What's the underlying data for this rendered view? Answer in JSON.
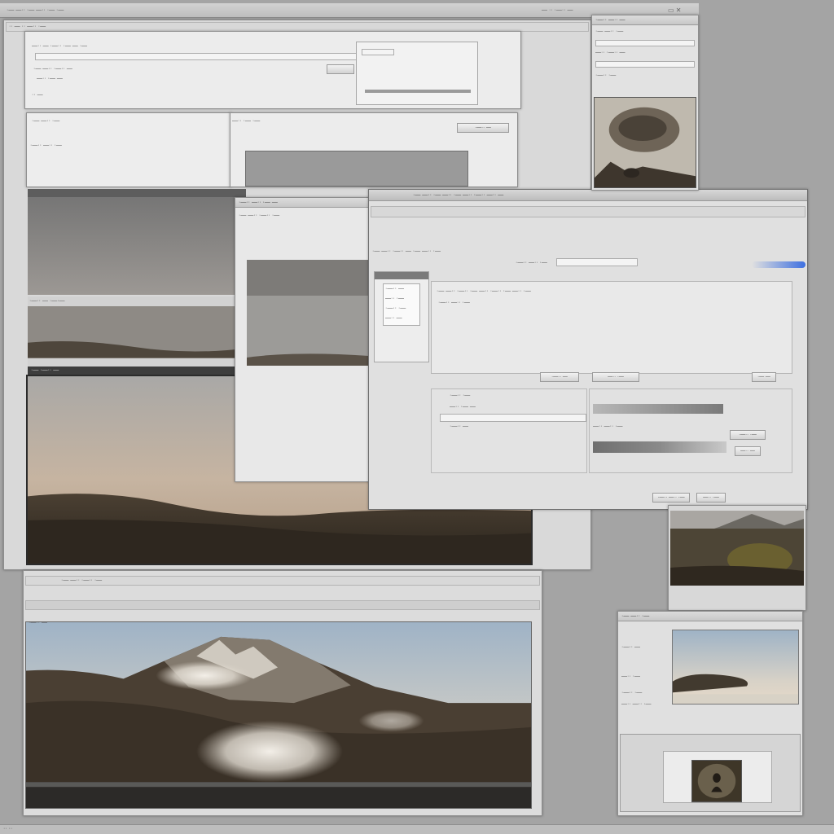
{
  "screen": {
    "title": "Photo editing workspace with overlapping windows",
    "top_status": "— ·· ·—·· —",
    "bottom_status": "·· ··"
  },
  "windows": {
    "main": {
      "title": "·— —·· ·— —·· ·— ·—",
      "toolbar_text": "·· — ·· —·· ·—",
      "row1": "—·· — ·—·· ·— — ·—",
      "row2": "·— —·· ·—·· —",
      "row3": "—·· ·— —",
      "row4": "·· —",
      "panel_left_title": "·— —·· ·—",
      "panel_right_title": "—·· ·— ·—",
      "panel_right_btn": "·—·· —",
      "label_a": "·—·· —·· ·—",
      "strip_label": "·—·· — ·—·—",
      "image_label": "·— ·—·· —"
    },
    "bottom": {
      "toolbar_text": "·— —·· ·—·· ·—",
      "image_label": "·—·· —"
    },
    "dialog": {
      "title": "·— —·· ·— —·· ·— —·· ·—·· —·· —",
      "heading": "·— —·· ·—·· — ·— —·· ·—",
      "search_label": "·—·· —·· ·—",
      "list_items": [
        "·—·· —",
        "—·· ·—",
        "·—·· ·—",
        "—·· —"
      ],
      "path_text": "·— —·· ·—·· ·— —·· ·—·· ·— —·· ·—",
      "option_a": "·—·· —·· ·—",
      "option_b": "—·· ·— —",
      "option_c": "·—·· —",
      "sub_label_1": "·—·· ·—",
      "sub_label_2": "—·· —·· ·—",
      "btn_1": "·—·· —",
      "btn_2": "—·· ·—",
      "btn_3": "·— —",
      "btn_4": "·—·· ·—",
      "btn_5": "—·· —",
      "btn_ok": "·—·· —·· ·—",
      "btn_cancel": "—·· ·—"
    },
    "right_top": {
      "title": "·—·· —·· —",
      "row1": "·— —·· ·—",
      "row2": "—·· ·—·· —",
      "row3": "·—·· ·—"
    },
    "right_bottom": {
      "title": "·— —·· ·—",
      "labels": [
        "·—·· —",
        "—·· ·—",
        "·—·· ·—",
        "—·· —·· ·—"
      ]
    },
    "mid_panel": {
      "title": "·—·· —·· ·— —",
      "row1": "·— —·· ·—·· ·—"
    }
  },
  "colors": {
    "accent": "#3d6fe0",
    "sky_warm": "#c5b4a2",
    "ground_dark": "#3b3227"
  }
}
